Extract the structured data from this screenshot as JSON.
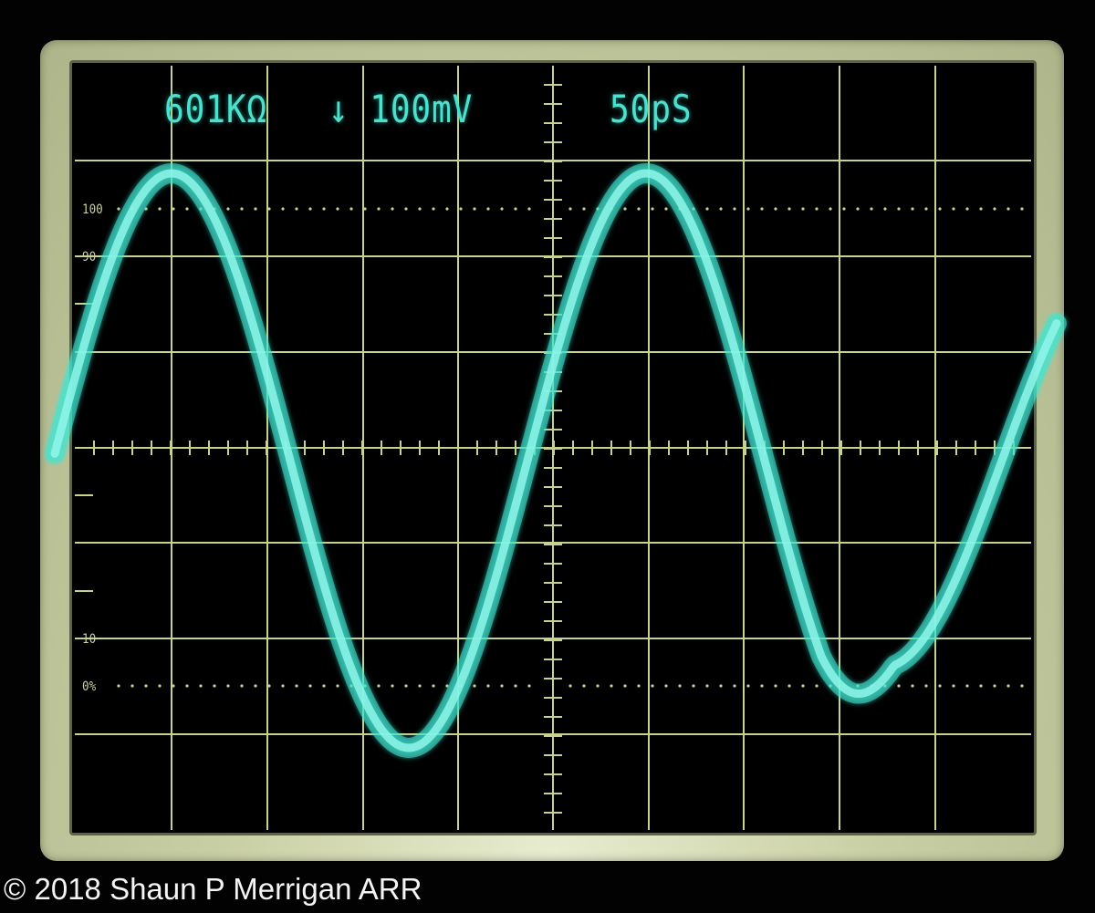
{
  "scope": {
    "readouts": {
      "impedance": "601KΩ",
      "vertical": "↓ 100mV",
      "timebase": "50pS"
    },
    "scale_labels": {
      "l100": "100",
      "l90": "90",
      "l10": "10",
      "l0": "0%"
    },
    "trace_color": "#3ee6d2",
    "graticule_color": "#c8d28e"
  },
  "footer": {
    "copyright": "© 2018 Shaun P Merrigan ARR"
  }
}
